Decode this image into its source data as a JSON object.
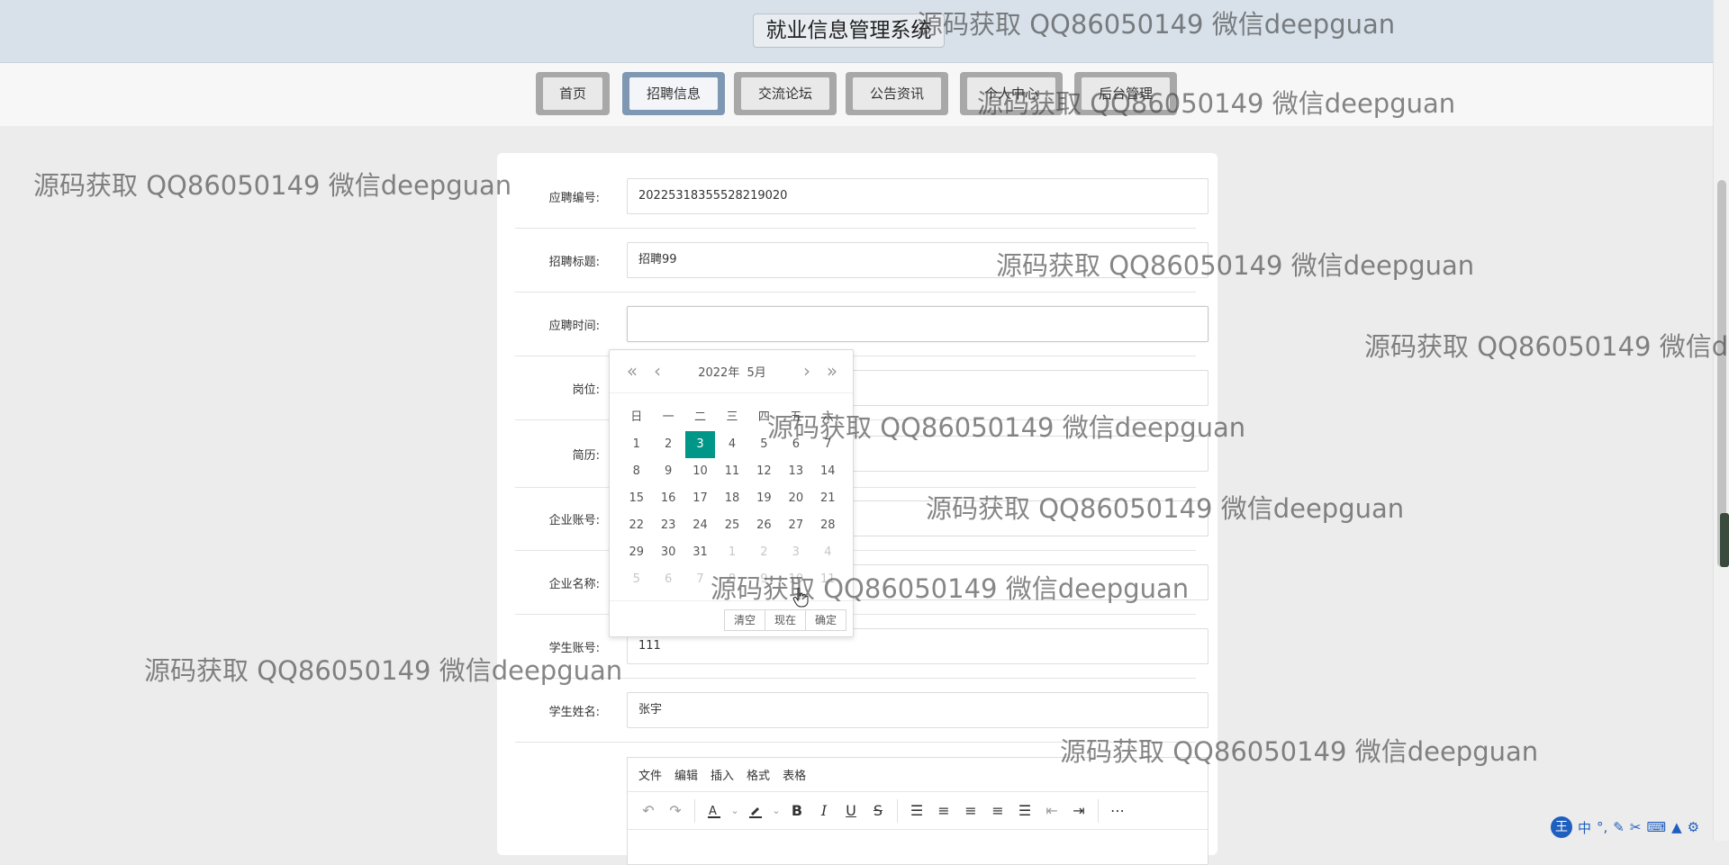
{
  "header": {
    "title": "就业信息管理系统"
  },
  "nav": {
    "items": [
      {
        "label": "首页"
      },
      {
        "label": "招聘信息"
      },
      {
        "label": "交流论坛"
      },
      {
        "label": "公告资讯"
      },
      {
        "label": "个人中心"
      },
      {
        "label": "后台管理"
      }
    ]
  },
  "form": {
    "fields": [
      {
        "label": "应聘编号:",
        "value": "20225318355528219020"
      },
      {
        "label": "招聘标题:",
        "value": "招聘99"
      },
      {
        "label": "应聘时间:",
        "value": ""
      },
      {
        "label": "岗位:",
        "value": ""
      },
      {
        "label": "简历:",
        "value": ""
      },
      {
        "label": "企业账号:",
        "value": ""
      },
      {
        "label": "企业名称:",
        "value": ""
      },
      {
        "label": "学生账号:",
        "value": "111"
      },
      {
        "label": "学生姓名:",
        "value": "张宇"
      }
    ]
  },
  "editor": {
    "menus": [
      "文件",
      "编辑",
      "插入",
      "格式",
      "表格"
    ]
  },
  "datepicker": {
    "title_year": "2022年",
    "title_month": "5月",
    "weekdays": [
      "日",
      "一",
      "二",
      "三",
      "四",
      "五",
      "六"
    ],
    "rows": [
      [
        "1",
        "2",
        "3",
        "4",
        "5",
        "6",
        "7"
      ],
      [
        "8",
        "9",
        "10",
        "11",
        "12",
        "13",
        "14"
      ],
      [
        "15",
        "16",
        "17",
        "18",
        "19",
        "20",
        "21"
      ],
      [
        "22",
        "23",
        "24",
        "25",
        "26",
        "27",
        "28"
      ],
      [
        "29",
        "30",
        "31",
        "1",
        "2",
        "3",
        "4"
      ],
      [
        "5",
        "6",
        "7",
        "8",
        "9",
        "10",
        "11"
      ]
    ],
    "selected_day": "3",
    "buttons": {
      "clear": "清空",
      "now": "现在",
      "confirm": "确定"
    }
  },
  "watermark": {
    "text": "源码获取 QQ86050149 微信deepguan"
  },
  "ime": {
    "badge": "王",
    "lang": "中"
  },
  "colors": {
    "accent": "#009688",
    "header_bg": "#d8e1ea",
    "active_tab": "#7e98b4"
  }
}
